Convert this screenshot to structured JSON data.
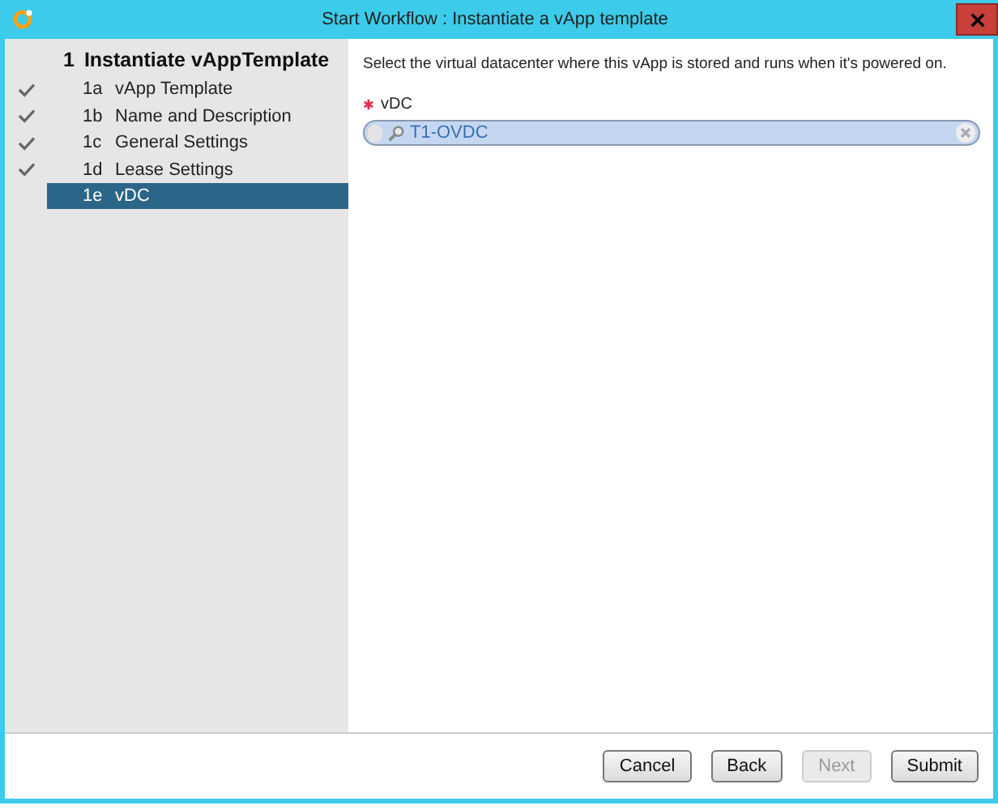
{
  "window": {
    "title": "Start Workflow : Instantiate a vApp template"
  },
  "steps": {
    "number": "1",
    "title": "Instantiate vAppTemplate",
    "items": [
      {
        "number": "1a",
        "label": "vApp Template",
        "done": true,
        "selected": false
      },
      {
        "number": "1b",
        "label": "Name and Description",
        "done": true,
        "selected": false
      },
      {
        "number": "1c",
        "label": "General Settings",
        "done": true,
        "selected": false
      },
      {
        "number": "1d",
        "label": "Lease Settings",
        "done": true,
        "selected": false
      },
      {
        "number": "1e",
        "label": "vDC",
        "done": false,
        "selected": true
      }
    ]
  },
  "content": {
    "description": "Select the virtual datacenter where this vApp is stored and runs when it's powered on.",
    "field": {
      "label": "vDC",
      "required": true,
      "value": "T1-OVDC"
    }
  },
  "buttons": [
    {
      "label": "Cancel",
      "disabled": false
    },
    {
      "label": "Back",
      "disabled": false
    },
    {
      "label": "Next",
      "disabled": true
    },
    {
      "label": "Submit",
      "disabled": false
    }
  ]
}
